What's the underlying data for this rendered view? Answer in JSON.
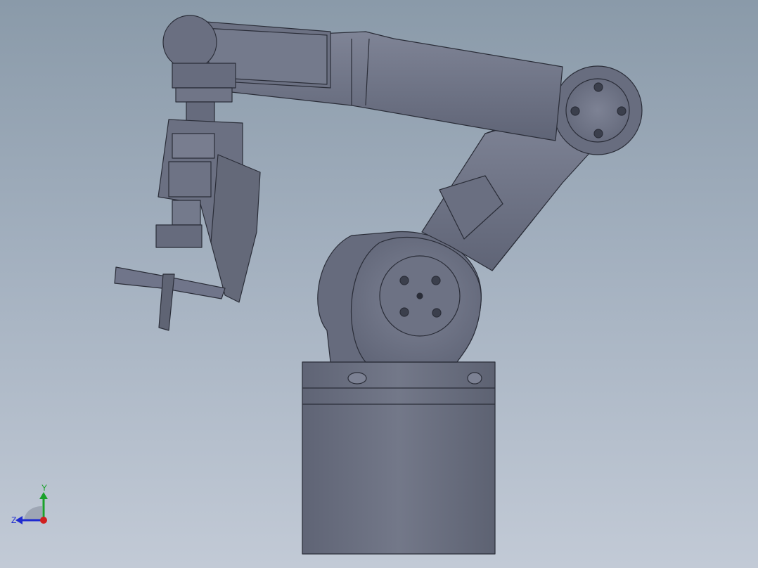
{
  "viewport": {
    "background_top": "#8a9aa9",
    "background_bottom": "#c2cad6",
    "model_name": "robotic-arm-with-drill-end-effector",
    "part_color": "#6f7485",
    "edge_color": "#2a2d38"
  },
  "triad": {
    "y_label": "Y",
    "z_label": "Z",
    "y_color": "#1aa12a",
    "z_color": "#1f2bd0",
    "x_color": "#d01f1f"
  }
}
